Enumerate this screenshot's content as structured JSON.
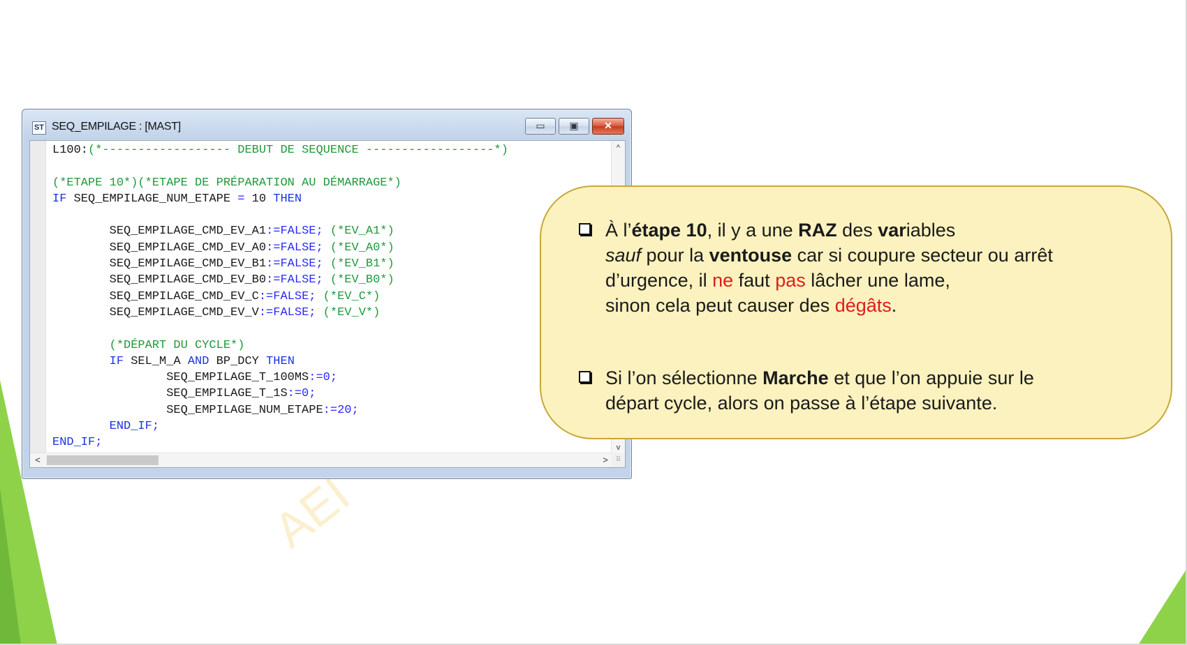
{
  "window": {
    "icon_text": "ST",
    "title": "SEQ_EMPILAGE : [MAST]",
    "buttons": {
      "minimize": "▭",
      "maximize": "▣",
      "close": "✕"
    },
    "scroll_arrows": {
      "up": "^",
      "down": "v",
      "left": "<",
      "right": ">",
      "grip": "⠿"
    }
  },
  "code_lines": [
    [
      {
        "t": "L100:",
        "c": "id"
      },
      {
        "t": "(*------------------ DEBUT DE SEQUENCE ------------------*)",
        "c": "cm"
      }
    ],
    [],
    [
      {
        "t": "(*ETAPE 10*)(*ETAPE DE PRÉPARATION AU DÉMARRAGE*)",
        "c": "cm"
      }
    ],
    [
      {
        "t": "IF",
        "c": "kw"
      },
      {
        "t": " SEQ_EMPILAGE_NUM_ETAPE ",
        "c": "id"
      },
      {
        "t": "=",
        "c": "op"
      },
      {
        "t": " 10 ",
        "c": "id"
      },
      {
        "t": "THEN",
        "c": "kw"
      }
    ],
    [],
    [
      {
        "t": "        SEQ_EMPILAGE_CMD_EV_A1",
        "c": "id"
      },
      {
        "t": ":=FALSE;",
        "c": "op"
      },
      {
        "t": " (*EV_A1*)",
        "c": "cm"
      }
    ],
    [
      {
        "t": "        SEQ_EMPILAGE_CMD_EV_A0",
        "c": "id"
      },
      {
        "t": ":=FALSE;",
        "c": "op"
      },
      {
        "t": " (*EV_A0*)",
        "c": "cm"
      }
    ],
    [
      {
        "t": "        SEQ_EMPILAGE_CMD_EV_B1",
        "c": "id"
      },
      {
        "t": ":=FALSE;",
        "c": "op"
      },
      {
        "t": " (*EV_B1*)",
        "c": "cm"
      }
    ],
    [
      {
        "t": "        SEQ_EMPILAGE_CMD_EV_B0",
        "c": "id"
      },
      {
        "t": ":=FALSE;",
        "c": "op"
      },
      {
        "t": " (*EV_B0*)",
        "c": "cm"
      }
    ],
    [
      {
        "t": "        SEQ_EMPILAGE_CMD_EV_C",
        "c": "id"
      },
      {
        "t": ":=FALSE;",
        "c": "op"
      },
      {
        "t": " (*EV_C*)",
        "c": "cm"
      }
    ],
    [
      {
        "t": "        SEQ_EMPILAGE_CMD_EV_V",
        "c": "id"
      },
      {
        "t": ":=FALSE;",
        "c": "op"
      },
      {
        "t": " (*EV_V*)",
        "c": "cm"
      }
    ],
    [],
    [
      {
        "t": "        (*DÉPART DU CYCLE*)",
        "c": "cm"
      }
    ],
    [
      {
        "t": "        ",
        "c": "id"
      },
      {
        "t": "IF",
        "c": "kw"
      },
      {
        "t": " SEL_M_A ",
        "c": "id"
      },
      {
        "t": "AND",
        "c": "kw"
      },
      {
        "t": " BP_DCY ",
        "c": "id"
      },
      {
        "t": "THEN",
        "c": "kw"
      }
    ],
    [
      {
        "t": "                SEQ_EMPILAGE_T_100MS",
        "c": "id"
      },
      {
        "t": ":=0;",
        "c": "op"
      }
    ],
    [
      {
        "t": "                SEQ_EMPILAGE_T_1S",
        "c": "id"
      },
      {
        "t": ":=0;",
        "c": "op"
      }
    ],
    [
      {
        "t": "                SEQ_EMPILAGE_NUM_ETAPE",
        "c": "id"
      },
      {
        "t": ":=20;",
        "c": "op"
      }
    ],
    [
      {
        "t": "        ",
        "c": "id"
      },
      {
        "t": "END_IF",
        "c": "kw"
      },
      {
        "t": ";",
        "c": "op"
      }
    ],
    [
      {
        "t": "END_IF",
        "c": "kw"
      },
      {
        "t": ";",
        "c": "op"
      }
    ]
  ],
  "callout": {
    "bullet1": [
      {
        "t": "À l’",
        "s": ""
      },
      {
        "t": "étape 10",
        "s": "b"
      },
      {
        "t": ", il y a une ",
        "s": ""
      },
      {
        "t": "RAZ",
        "s": "b"
      },
      {
        "t": " des ",
        "s": ""
      },
      {
        "t": "var",
        "s": "b"
      },
      {
        "t": "iables",
        "s": ""
      },
      {
        "t": "\n",
        "s": "br"
      },
      {
        "t": "sauf",
        "s": "i"
      },
      {
        "t": " pour la ",
        "s": ""
      },
      {
        "t": "ventouse",
        "s": "b"
      },
      {
        "t": " car si coupure secteur ou arrêt",
        "s": ""
      },
      {
        "t": "\n",
        "s": "br"
      },
      {
        "t": "d’urgence, il ",
        "s": ""
      },
      {
        "t": "ne",
        "s": "red"
      },
      {
        "t": " faut ",
        "s": ""
      },
      {
        "t": "pas",
        "s": "red"
      },
      {
        "t": " lâcher une lame,",
        "s": ""
      },
      {
        "t": "\n",
        "s": "br"
      },
      {
        "t": "sinon cela peut causer des ",
        "s": ""
      },
      {
        "t": "dégâts",
        "s": "red"
      },
      {
        "t": ".",
        "s": ""
      }
    ],
    "bullet2": [
      {
        "t": "Si l’on sélectionne ",
        "s": ""
      },
      {
        "t": "Marche",
        "s": "b"
      },
      {
        "t": " et que l’on appuie sur le",
        "s": ""
      },
      {
        "t": "\n",
        "s": "br"
      },
      {
        "t": "départ cycle, alors on passe à l’étape suivante.",
        "s": ""
      }
    ]
  },
  "watermark": "AEI",
  "colors": {
    "keyword": "#1c33e0",
    "comment": "#1f9a3a",
    "callout_bg": "#fcf2bf",
    "callout_border": "#c7a835",
    "highlight": "#e01b1b",
    "deco_green": "#8ed24a"
  }
}
